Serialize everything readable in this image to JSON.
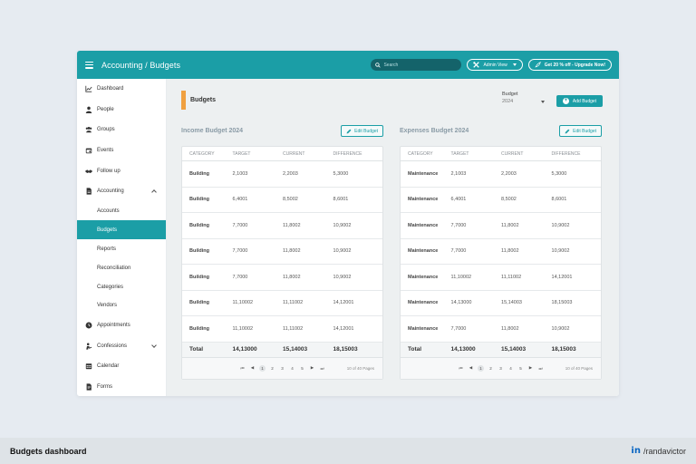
{
  "topbar": {
    "breadcrumb": "Accounting / Budgets",
    "search_placeholder": "Search",
    "admin_view_label": "Admin View",
    "upgrade_label": "Get 20 % off - Upgrade Now!"
  },
  "sidebar": {
    "items": [
      {
        "label": "Dashboard",
        "icon": "chart-line-icon"
      },
      {
        "label": "People",
        "icon": "person-icon"
      },
      {
        "label": "Groups",
        "icon": "group-icon"
      },
      {
        "label": "Events",
        "icon": "calendar-event-icon"
      },
      {
        "label": "Follow up",
        "icon": "handshake-icon"
      },
      {
        "label": "Accounting",
        "icon": "file-icon"
      }
    ],
    "sub_items": [
      "Accounts",
      "Budgets",
      "Reports",
      "Reconciliation",
      "Categories",
      "Vendors"
    ],
    "active_sub": "Budgets",
    "items_after": [
      {
        "label": "Appointments",
        "icon": "clock-icon"
      },
      {
        "label": "Confessions",
        "icon": "confession-icon"
      },
      {
        "label": "Calendar",
        "icon": "calendar-icon"
      },
      {
        "label": "Forms",
        "icon": "form-icon"
      }
    ]
  },
  "main": {
    "title": "Budgets",
    "budget_select": {
      "label": "Budget",
      "value": "2024"
    },
    "add_budget_label": "Add Budget",
    "edit_budget_label": "Edit Budget",
    "columns": [
      "CATEGORY",
      "TARGET",
      "CURRENT",
      "DIFFERENCE"
    ],
    "income": {
      "title": "Income Budget 2024",
      "rows": [
        [
          "Building",
          "2,1003",
          "2,2003",
          "5,3000"
        ],
        [
          "Building",
          "6,4001",
          "8,5002",
          "8,6001"
        ],
        [
          "Building",
          "7,7000",
          "11,8002",
          "10,9002"
        ],
        [
          "Building",
          "7,7000",
          "11,8002",
          "10,9002"
        ],
        [
          "Building",
          "7,7000",
          "11,8002",
          "10,9002"
        ],
        [
          "Building",
          "11,10002",
          "11,11002",
          "14,12001"
        ],
        [
          "Building",
          "11,10002",
          "11,11002",
          "14,12001"
        ]
      ],
      "total": [
        "Total",
        "14,13000",
        "15,14003",
        "18,15003"
      ]
    },
    "expenses": {
      "title": "Expenses Budget 2024",
      "rows": [
        [
          "Maintenance",
          "2,1003",
          "2,2003",
          "5,3000"
        ],
        [
          "Maintenance",
          "6,4001",
          "8,5002",
          "8,6001"
        ],
        [
          "Maintenance",
          "7,7000",
          "11,8002",
          "10,9002"
        ],
        [
          "Maintenance",
          "7,7000",
          "11,8002",
          "10,9002"
        ],
        [
          "Maintenance",
          "11,10002",
          "11,11002",
          "14,12001"
        ],
        [
          "Maintenance",
          "14,13000",
          "15,14003",
          "18,15003"
        ],
        [
          "Maintenance",
          "7,7000",
          "11,8002",
          "10,9002"
        ]
      ],
      "total": [
        "Total",
        "14,13000",
        "15,14003",
        "18,15003"
      ]
    },
    "pager": {
      "pages": [
        "1",
        "2",
        "3",
        "4",
        "5"
      ],
      "current": "1",
      "info": "10 of 40 Pages",
      "first": "⏮",
      "prev": "◀",
      "next": "▶",
      "last": "⏭"
    }
  },
  "footer": {
    "title": "Budgets dashboard",
    "linkedin_mark": "in",
    "handle": "/randavictor"
  },
  "colors": {
    "accent": "#1b9ea6",
    "accent_dark": "#14636a",
    "orange": "#f0a040",
    "linkedin": "#0a66c2"
  }
}
